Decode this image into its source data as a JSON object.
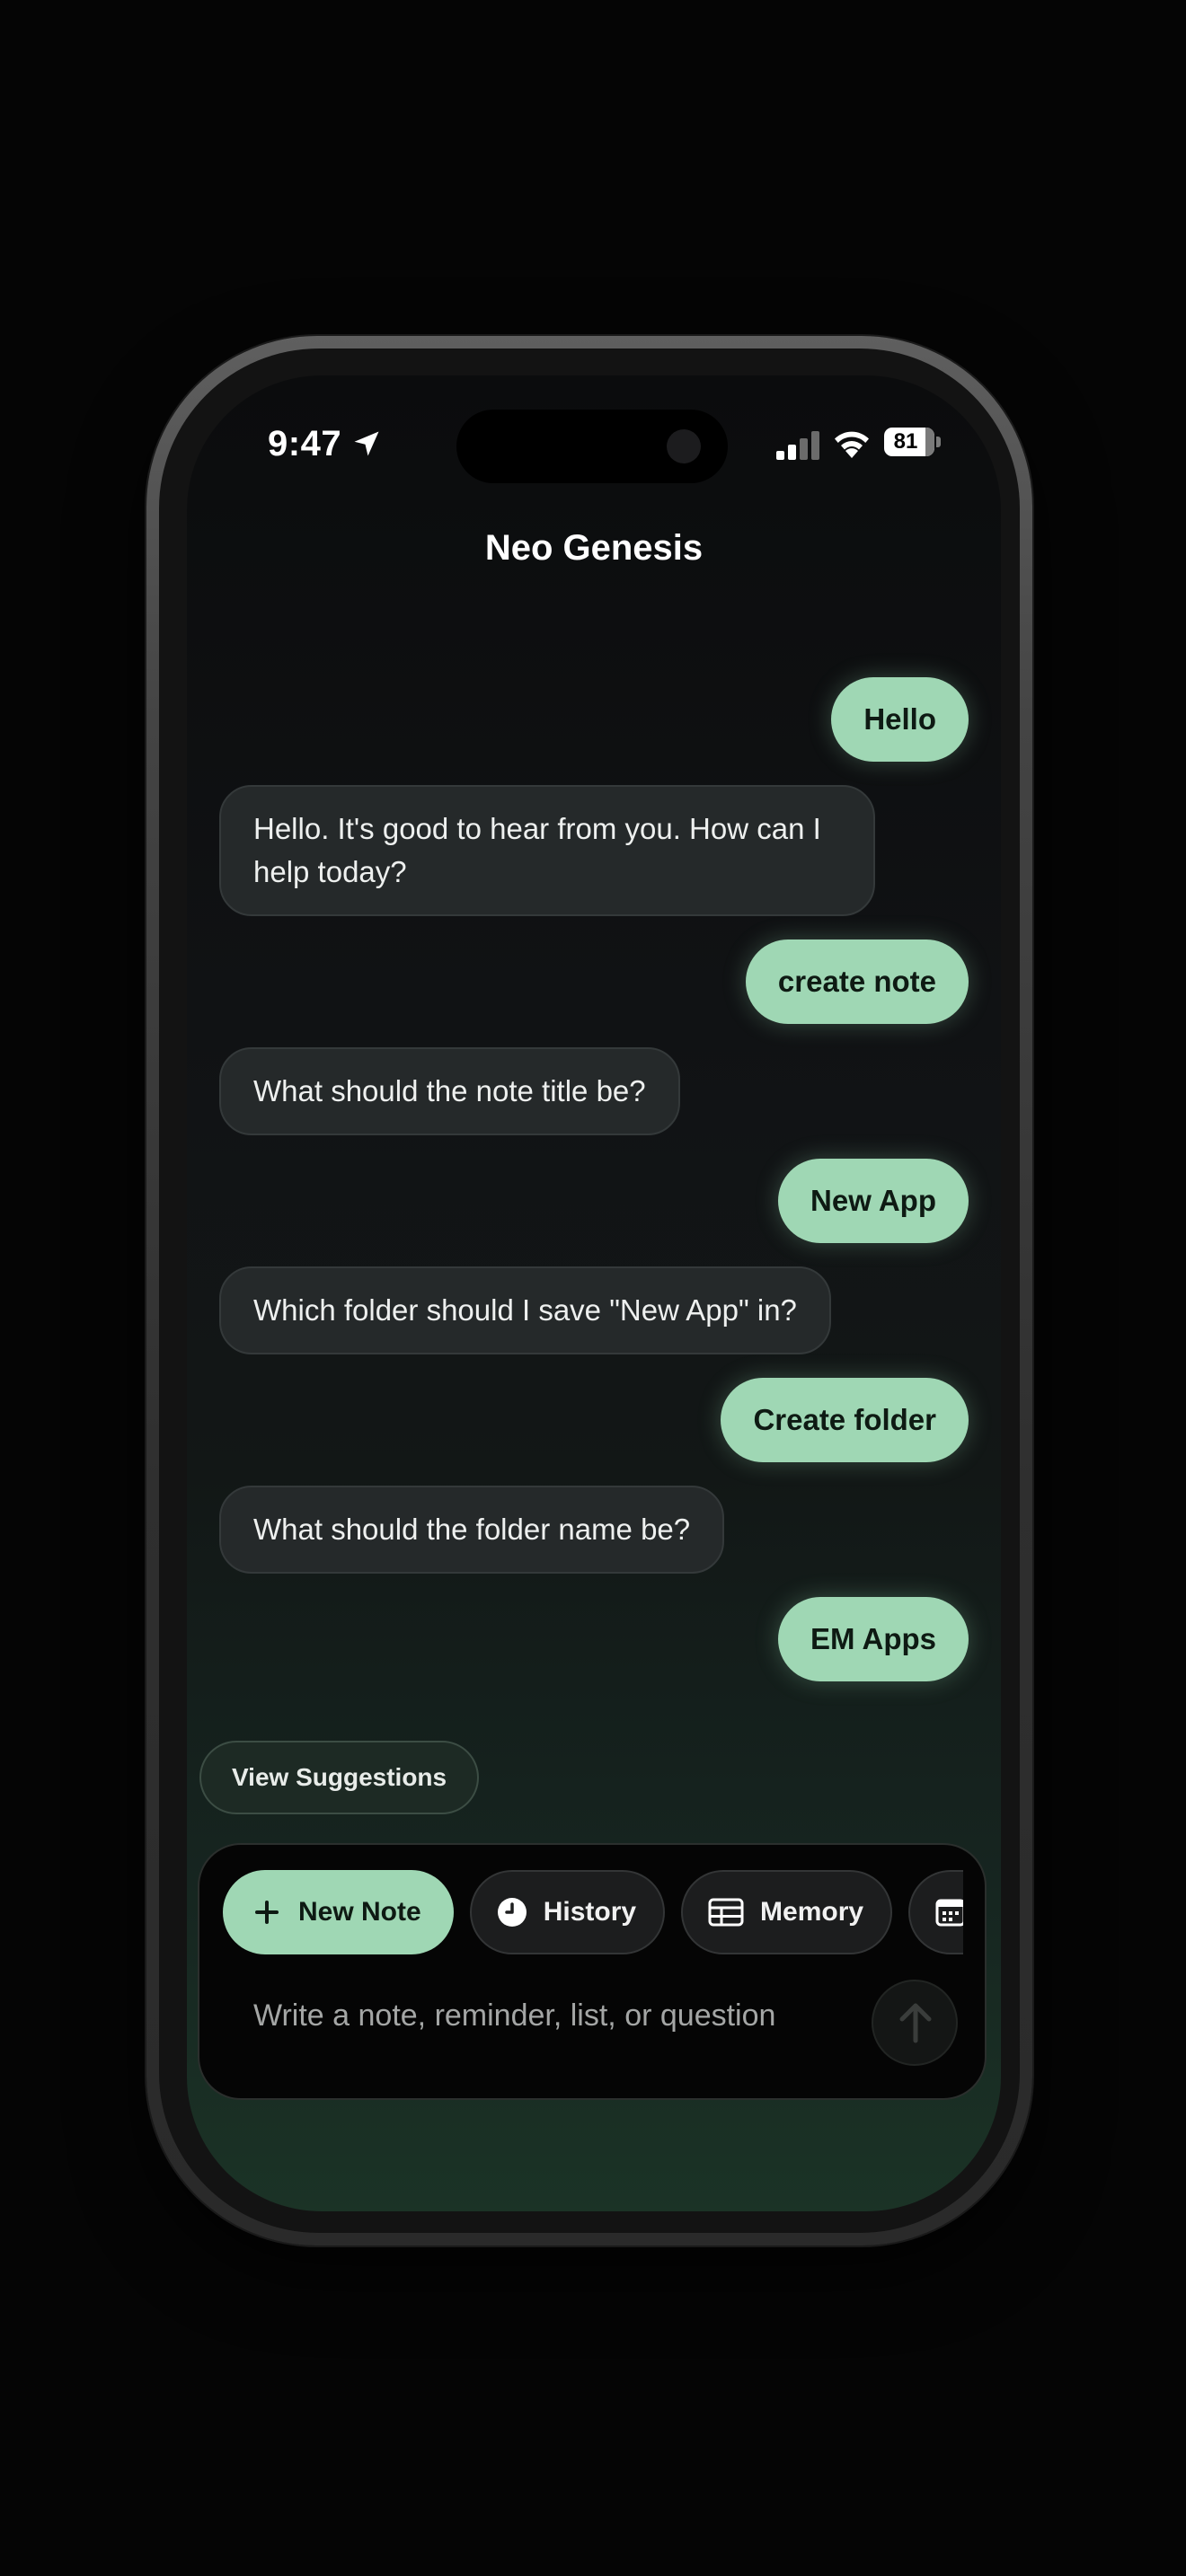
{
  "status_bar": {
    "time": "9:47",
    "battery": "81"
  },
  "header": {
    "title": "Neo Genesis"
  },
  "messages": [
    {
      "role": "user",
      "text": "Hello"
    },
    {
      "role": "assistant",
      "text": "Hello. It's good to hear from you. How can I help today?"
    },
    {
      "role": "user",
      "text": "create note"
    },
    {
      "role": "assistant",
      "text": "What should the note title be?"
    },
    {
      "role": "user",
      "text": "New App"
    },
    {
      "role": "assistant",
      "text": "Which folder should I save \"New App\" in?"
    },
    {
      "role": "user",
      "text": "Create folder"
    },
    {
      "role": "assistant",
      "text": "What should the folder name be?"
    },
    {
      "role": "user",
      "text": "EM Apps"
    }
  ],
  "suggestions": {
    "label": "View Suggestions"
  },
  "toolbar": {
    "chips": [
      {
        "label": "New Note",
        "icon": "plus-icon"
      },
      {
        "label": "History",
        "icon": "clock-icon"
      },
      {
        "label": "Memory",
        "icon": "table-icon"
      },
      {
        "label": "",
        "icon": "calendar-icon"
      }
    ]
  },
  "composer": {
    "placeholder": "Write a note, reminder, list, or question",
    "value": ""
  },
  "colors": {
    "accent": "#9fd7b4",
    "background": "#050505"
  }
}
